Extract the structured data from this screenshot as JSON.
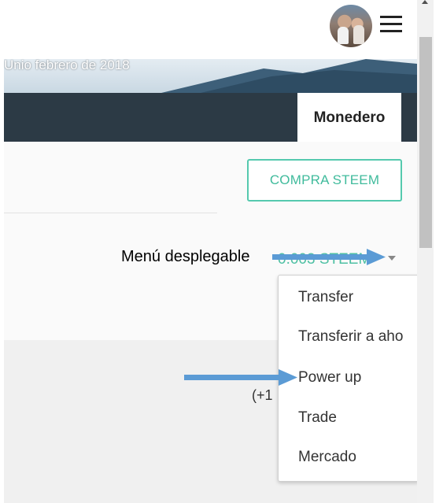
{
  "header": {
    "avatar_icon": "avatar-icon",
    "menu_icon": "hamburger-menu-icon"
  },
  "cover": {
    "text": "Unio febrero de 2018"
  },
  "nav": {
    "active_tab": "Monedero"
  },
  "wallet": {
    "buy_button": "COMPRA STEEM",
    "balance": "0.003 STEEM",
    "partial_text": "(+1",
    "accent_color": "#4fc0a4"
  },
  "dropdown": {
    "items": [
      "Transfer",
      "Transferir a aho",
      "Power up",
      "Trade",
      "Mercado"
    ]
  },
  "annotations": {
    "label": "Menú desplegable",
    "arrow_color": "#5b9bd5"
  }
}
